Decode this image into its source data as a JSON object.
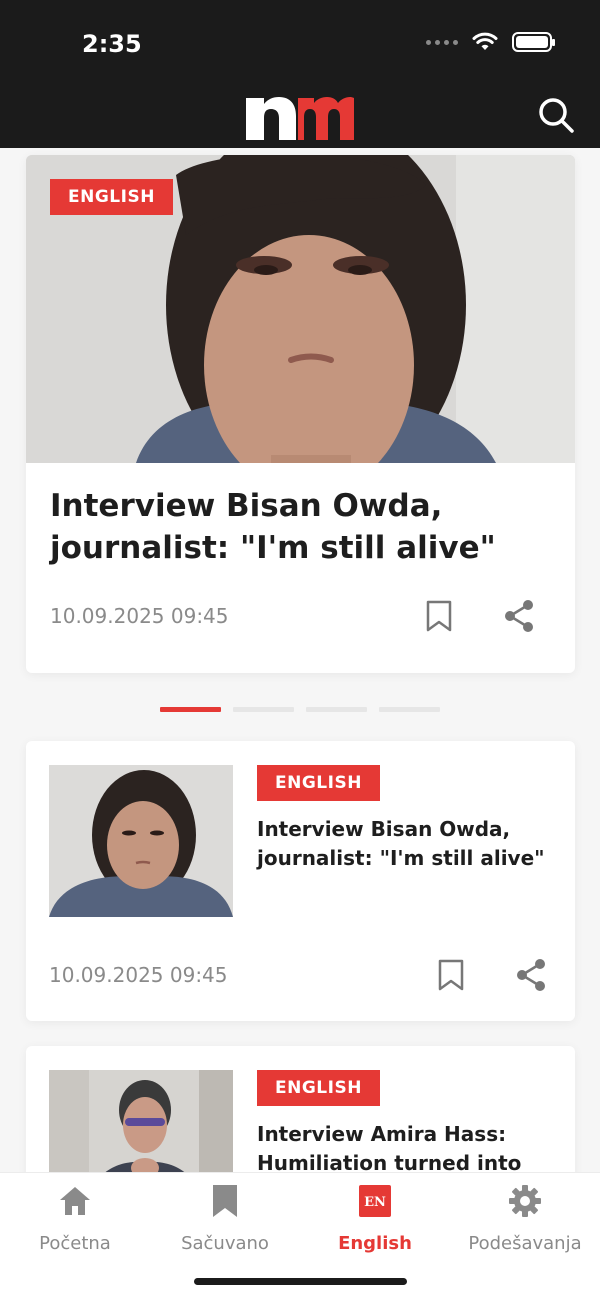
{
  "status_bar": {
    "time": "2:35"
  },
  "header": {
    "logo_text": "nm",
    "brand_color": "#e53935",
    "search_icon": "search-icon"
  },
  "featured": {
    "badge": "ENGLISH",
    "title": "Interview Bisan Owda, journalist: \"I'm still alive\"",
    "date": "10.09.2025 09:45"
  },
  "carousel": {
    "pages": 4,
    "active_page": 1
  },
  "articles": [
    {
      "badge": "ENGLISH",
      "title": "Interview Bisan Owda, journalist: \"I'm still alive\"",
      "date": "10.09.2025 09:45"
    },
    {
      "badge": "ENGLISH",
      "title": "Interview Amira Hass: Humiliation turned into"
    }
  ],
  "bottom_nav": {
    "items": [
      {
        "label": "Početna",
        "icon": "home-icon"
      },
      {
        "label": "Sačuvano",
        "icon": "bookmark-icon"
      },
      {
        "label": "English",
        "icon": "en-icon",
        "icon_text": "EN",
        "active": true
      },
      {
        "label": "Podešavanja",
        "icon": "gear-icon"
      }
    ]
  }
}
